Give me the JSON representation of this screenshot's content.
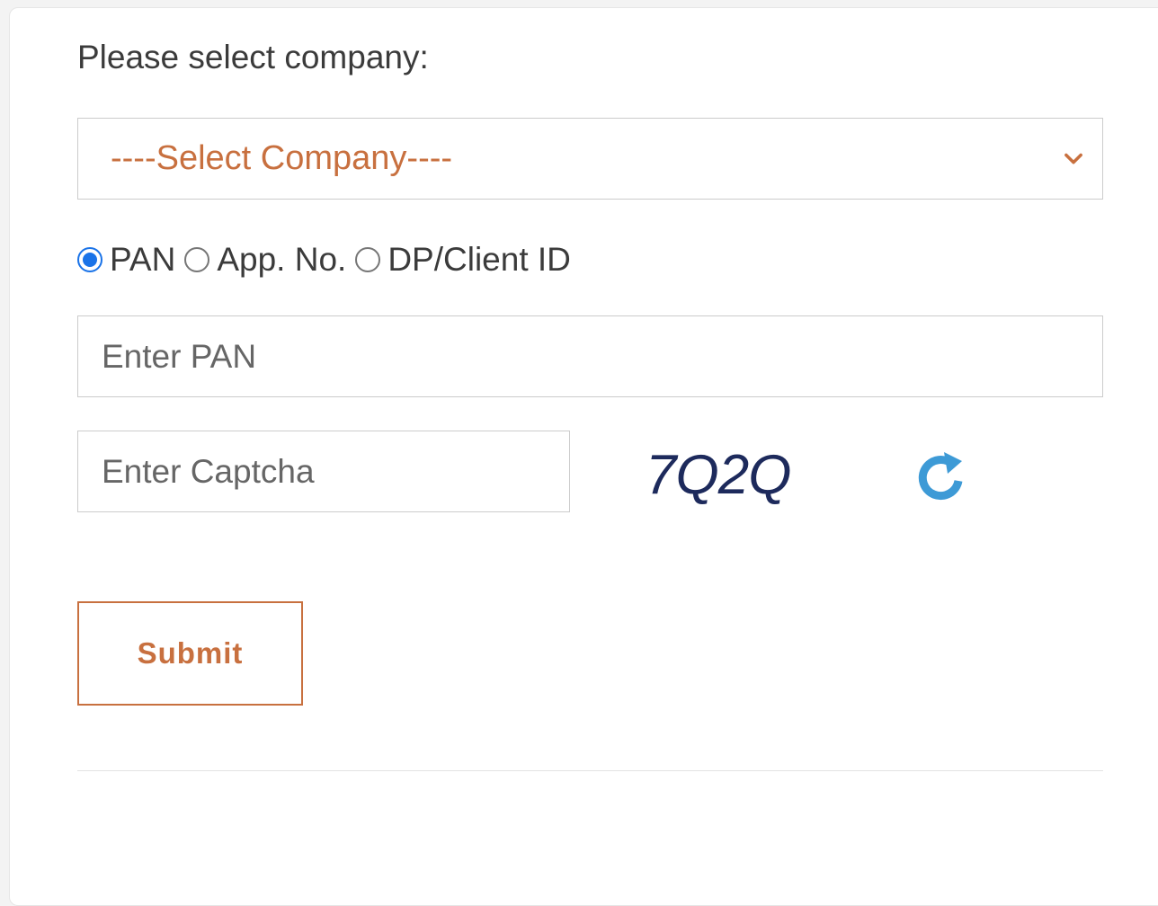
{
  "form": {
    "label": "Please select company:",
    "company_select": {
      "selected": "----Select Company----",
      "icon": "chevron-down-icon"
    },
    "id_type_options": [
      {
        "label": "PAN",
        "checked": true
      },
      {
        "label": "App. No.",
        "checked": false
      },
      {
        "label": "DP/Client ID",
        "checked": false
      }
    ],
    "pan_input": {
      "value": "",
      "placeholder": "Enter PAN"
    },
    "captcha_input": {
      "value": "",
      "placeholder": "Enter Captcha"
    },
    "captcha_text": "7Q2Q",
    "refresh_icon": "refresh-icon",
    "submit_label": "Submit"
  },
  "colors": {
    "accent": "#c8703f",
    "radio_checked": "#1a73e8",
    "captcha": "#1d2a5c",
    "refresh": "#3d9ad6"
  }
}
